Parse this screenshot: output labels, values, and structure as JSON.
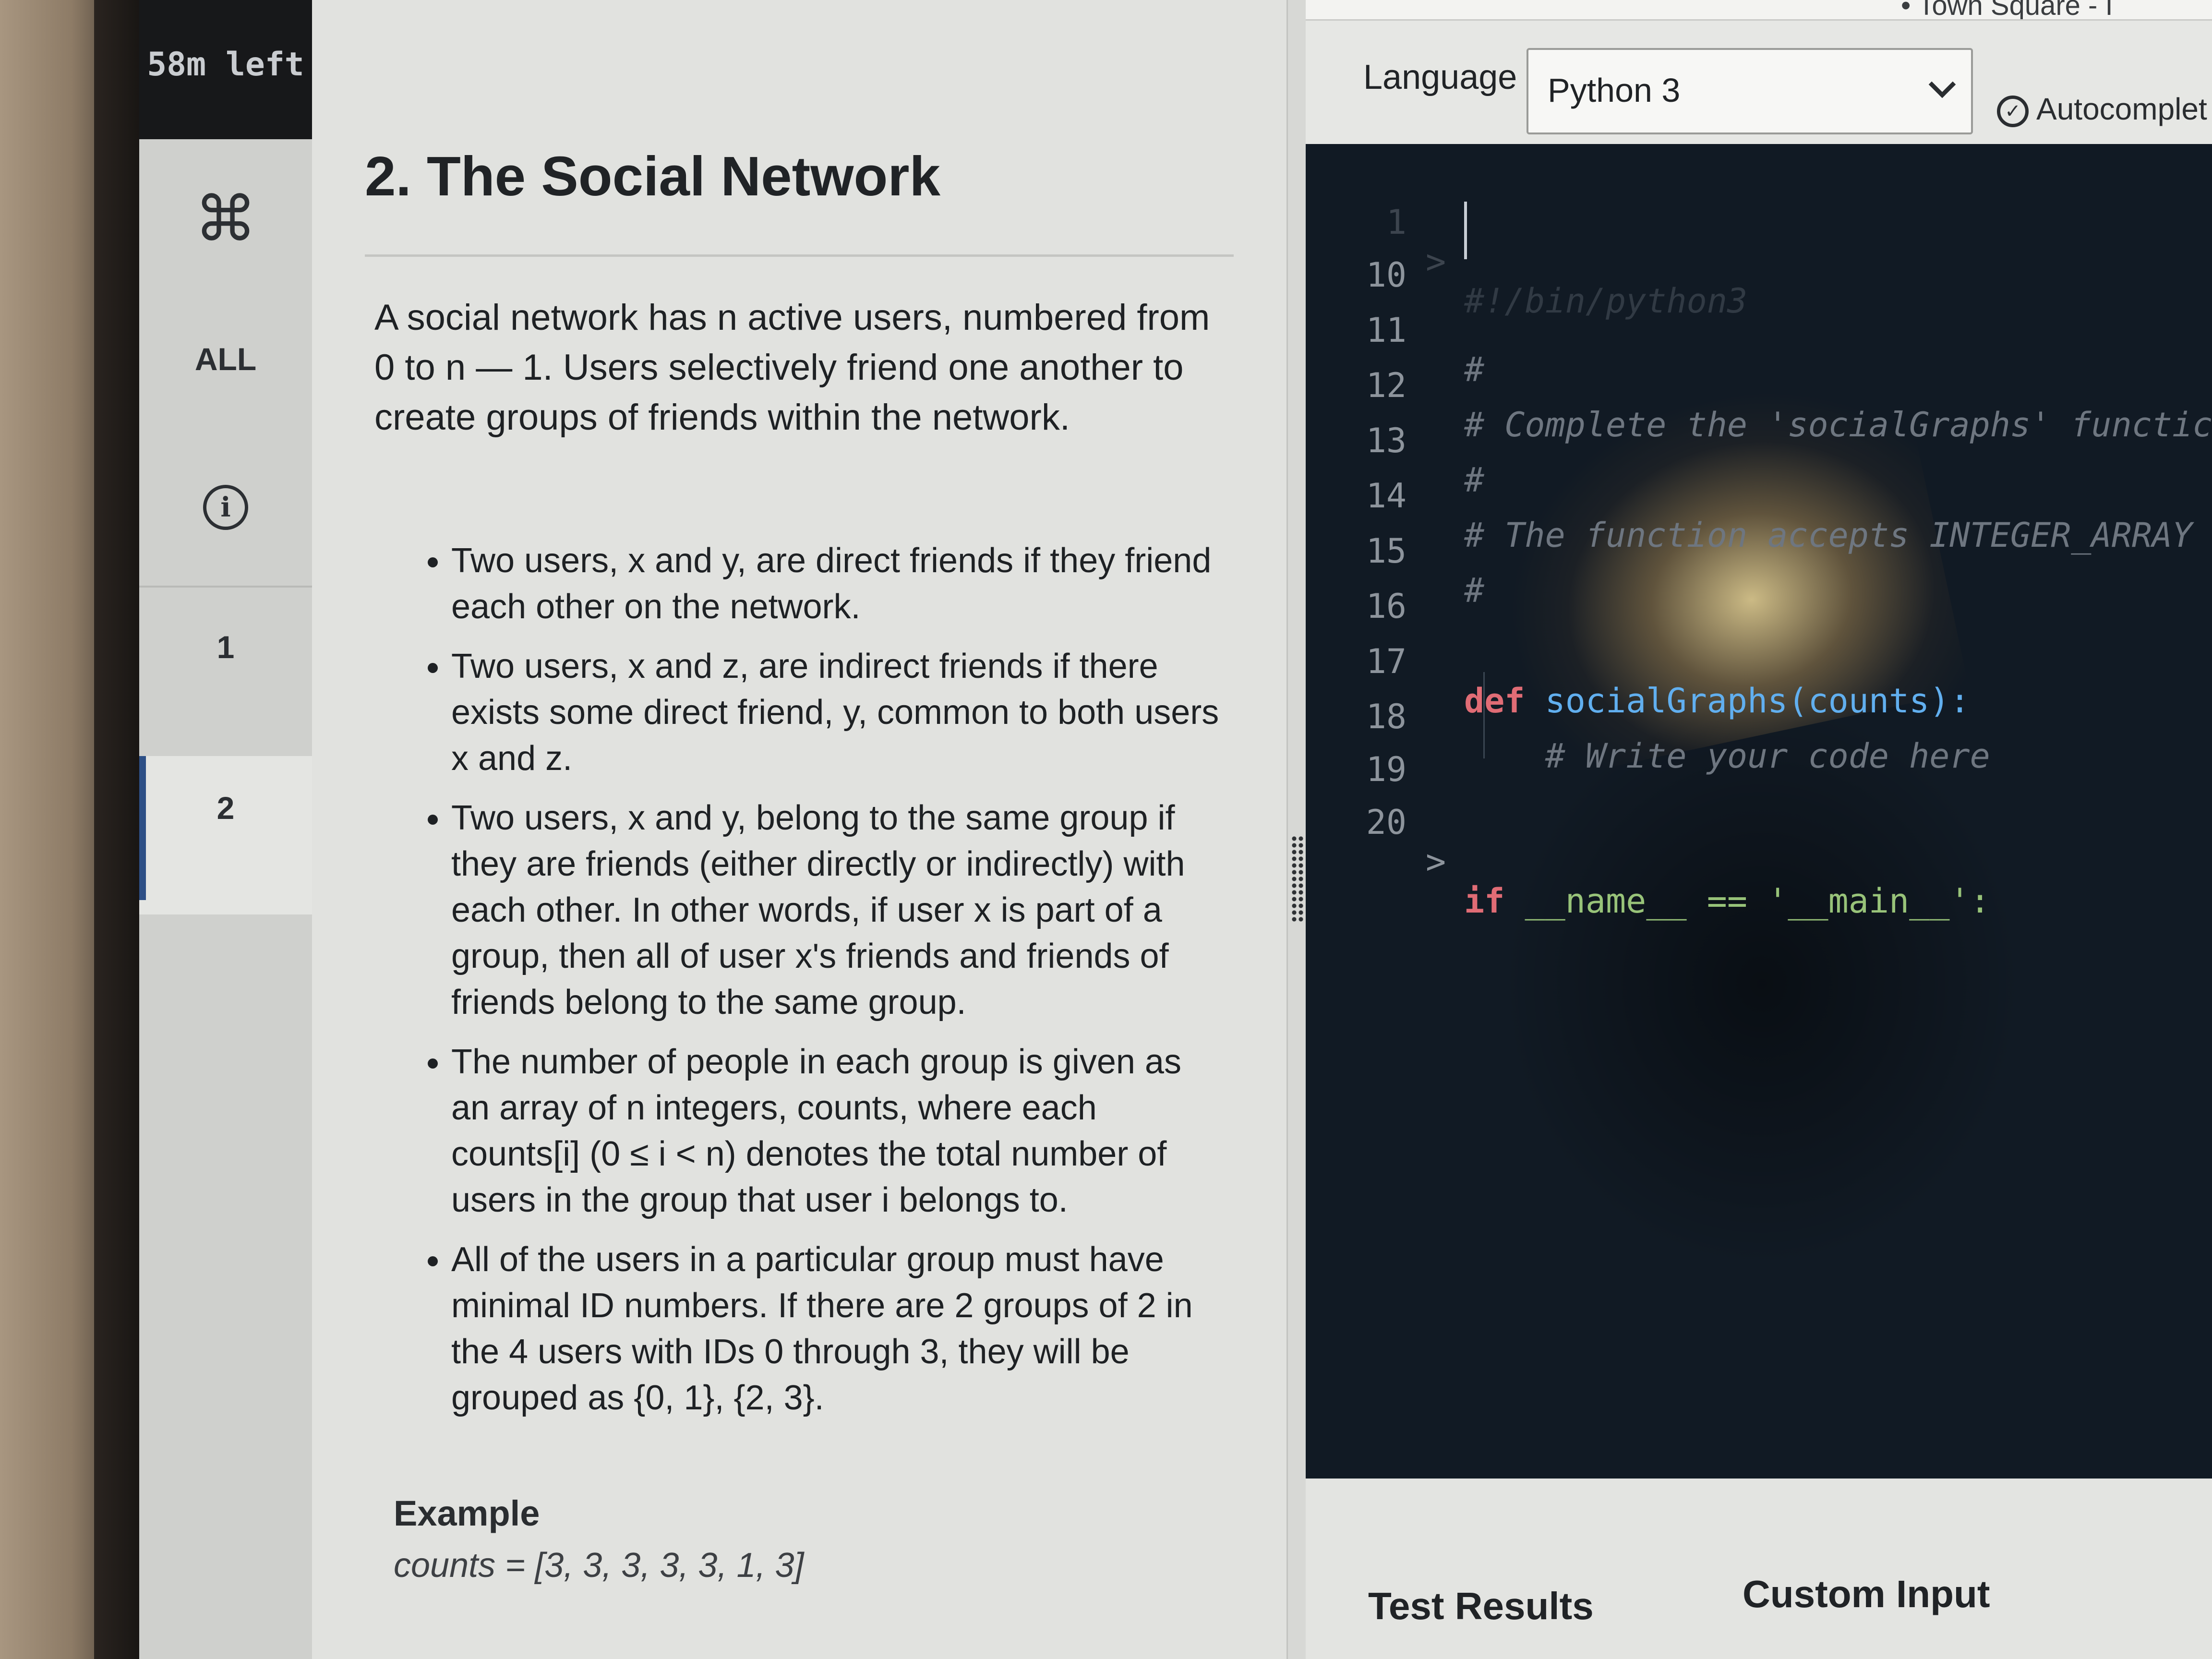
{
  "timer": {
    "text": "58m left"
  },
  "nav": {
    "cmd_icon": "command-icon",
    "all_label": "ALL",
    "info_icon": "info-icon",
    "questions": [
      "1",
      "2"
    ],
    "active_question": "2"
  },
  "problem": {
    "title": "2. The Social Network",
    "intro": "A social network has n active users, numbered from 0 to n — 1. Users selectively friend one another to create groups of friends within the network.",
    "bullets": [
      "Two users, x and y, are direct friends if they friend each other on the network.",
      "Two users, x and z, are indirect friends if there exists some direct friend, y, common to both users x and z.",
      "Two users, x and y, belong to the same group if they are friends (either directly or indirectly) with each other. In other words, if user x is part of a group, then all of user x's friends and friends of friends belong to the same group.",
      "The number of people in each group is given as an array of n integers, counts, where each counts[i] (0 ≤ i < n) denotes the total number of users in the group that user i belongs to.",
      "All of the users in a particular group must have minimal ID numbers. If there are 2 groups of 2 in the 4 users with IDs 0 through 3, they will be grouped as {0, 1}, {2, 3}."
    ],
    "example_label": "Example",
    "example_value": "counts = [3, 3, 3, 3, 3, 1, 3]"
  },
  "editor": {
    "tab_title": "• Town Square - I",
    "language_label": "Language",
    "language_value": "Python 3",
    "autocomplete_label": "Autocomplet",
    "lines": [
      {
        "num": "1",
        "fold": ">",
        "text": "#!/bin/python3",
        "kind": "comment-faded"
      },
      {
        "num": "10",
        "fold": "",
        "text": "",
        "kind": "cursor"
      },
      {
        "num": "11",
        "fold": "",
        "text": "#",
        "kind": "comment"
      },
      {
        "num": "12",
        "fold": "",
        "text": "# Complete the 'socialGraphs' functic",
        "kind": "comment"
      },
      {
        "num": "13",
        "fold": "",
        "text": "#",
        "kind": "comment"
      },
      {
        "num": "14",
        "fold": "",
        "text": "# The function accepts INTEGER_ARRAY",
        "kind": "comment"
      },
      {
        "num": "15",
        "fold": "",
        "text": "#",
        "kind": "comment"
      },
      {
        "num": "16",
        "fold": "",
        "text": "",
        "kind": "blank"
      },
      {
        "num": "17",
        "fold": "",
        "text": "socialGraphs(counts):",
        "kind": "def"
      },
      {
        "num": "18",
        "fold": "",
        "text": "    # Write your code here",
        "kind": "comment"
      },
      {
        "num": "19",
        "fold": "",
        "text": "",
        "kind": "blank"
      },
      {
        "num": "20",
        "fold": ">",
        "text": "__name__ == '__main__':",
        "kind": "if"
      }
    ],
    "def_keyword": "def",
    "if_keyword": "if"
  },
  "bottom_tabs": {
    "test_results": "Test Results",
    "custom_input": "Custom Input"
  }
}
